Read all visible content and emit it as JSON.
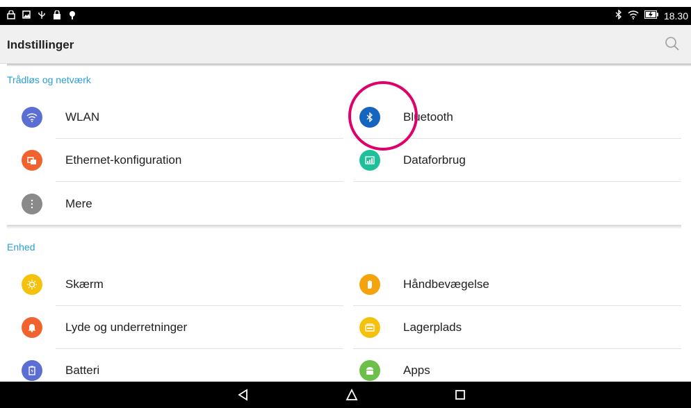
{
  "status": {
    "time": "18.30"
  },
  "app": {
    "title": "Indstillinger"
  },
  "sections": [
    {
      "header": "Trådløs og netværk",
      "left": [
        {
          "label": "WLAN",
          "icon": "wifi-icon",
          "color": "#5b6ed4"
        },
        {
          "label": "Ethernet-konfiguration",
          "icon": "ethernet-icon",
          "color": "#f0622e"
        },
        {
          "label": "Mere",
          "icon": "more-icon",
          "color": "#8a8a8a"
        }
      ],
      "right": [
        {
          "label": "Bluetooth",
          "icon": "bluetooth-icon",
          "color": "#1565c0"
        },
        {
          "label": "Dataforbrug",
          "icon": "data-usage-icon",
          "color": "#1fbf9a"
        }
      ]
    },
    {
      "header": "Enhed",
      "left": [
        {
          "label": "Skærm",
          "icon": "display-icon",
          "color": "#f4c20d"
        },
        {
          "label": "Lyde og underretninger",
          "icon": "bell-icon",
          "color": "#f0622e"
        },
        {
          "label": "Batteri",
          "icon": "battery-icon",
          "color": "#5b6ed4"
        }
      ],
      "right": [
        {
          "label": "Håndbevægelse",
          "icon": "hand-icon",
          "color": "#f4a30d"
        },
        {
          "label": "Lagerplads",
          "icon": "storage-icon",
          "color": "#f4c20d"
        },
        {
          "label": "Apps",
          "icon": "android-icon",
          "color": "#6cc04a"
        }
      ]
    }
  ]
}
